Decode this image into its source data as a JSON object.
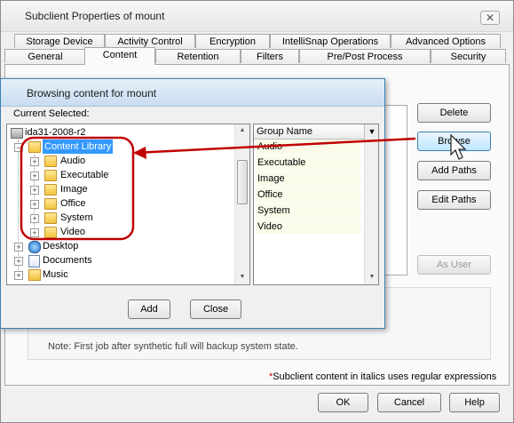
{
  "main_window": {
    "title": "Subclient Properties of mount",
    "close_glyph": "✕",
    "tabs_row1": [
      "Storage Device",
      "Activity Control",
      "Encryption",
      "IntelliSnap Operations",
      "Advanced Options"
    ],
    "tabs_row2": [
      "General",
      "Content",
      "Retention",
      "Filters",
      "Pre/Post Process",
      "Security"
    ],
    "active_tab": "Content",
    "buttons": {
      "delete": "Delete",
      "browse": "Browse",
      "add_paths": "Add Paths",
      "edit_paths": "Edit Paths",
      "as_user": "As User"
    },
    "note": "Note: First job after synthetic full will backup system state.",
    "italic_note_star": "*",
    "italic_note": "Subclient content in italics uses regular expressions",
    "footer": {
      "ok": "OK",
      "cancel": "Cancel",
      "help": "Help"
    }
  },
  "browse_dialog": {
    "title": "Browsing content for mount",
    "current_selected_label": "Current Selected:",
    "tree": {
      "root": "ida31-2008-r2",
      "selected": "Content Library",
      "library_children": [
        "Audio",
        "Executable",
        "Image",
        "Office",
        "System",
        "Video"
      ],
      "others": [
        "Desktop",
        "Documents",
        "Music"
      ]
    },
    "group_header": "Group Name",
    "group_items": [
      "Audio",
      "Executable",
      "Image",
      "Office",
      "System",
      "Video"
    ],
    "buttons": {
      "add": "Add",
      "close": "Close"
    }
  },
  "annotation": {
    "color": "#c00000"
  }
}
